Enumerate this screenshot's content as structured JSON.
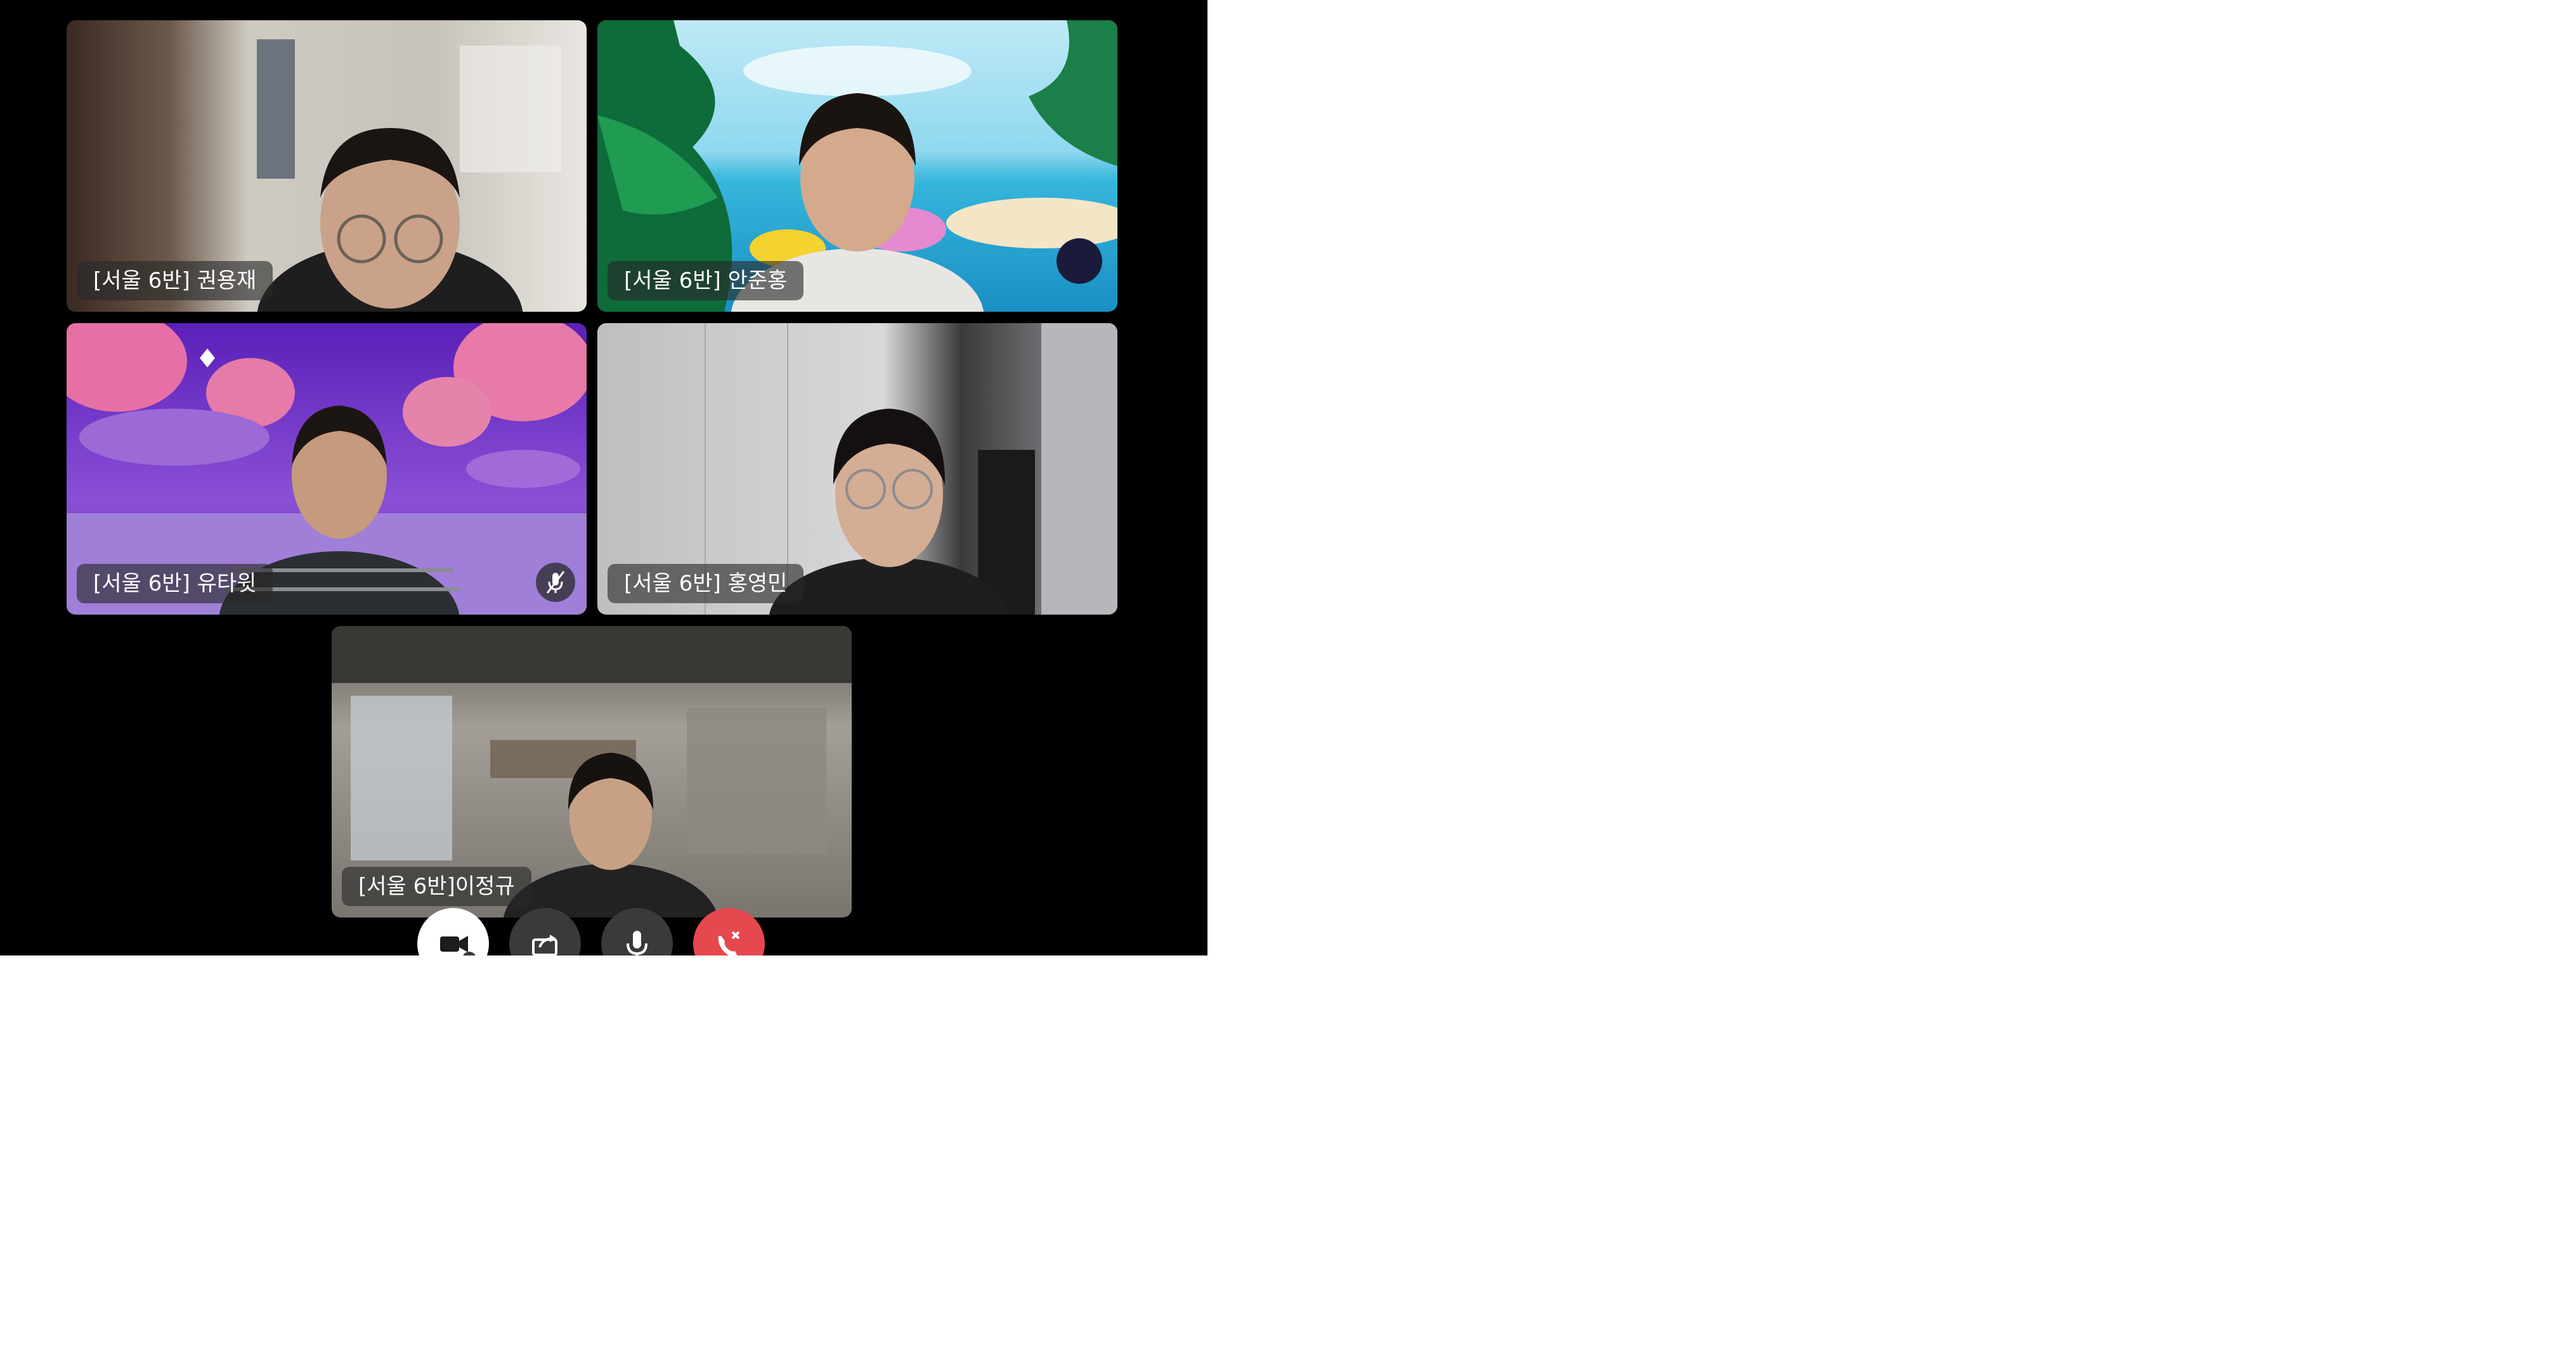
{
  "participants": [
    {
      "label": "[서울 6반] 권용재",
      "muted": false
    },
    {
      "label": "[서울 6반] 안준홍",
      "muted": false
    },
    {
      "label": "[서울 6반] 유타윗",
      "muted": true
    },
    {
      "label": "[서울 6반] 홍영민",
      "muted": false
    },
    {
      "label": "[서울 6반]이정규",
      "muted": false
    }
  ],
  "controls": {
    "camera": {
      "icon": "video-camera-icon",
      "state": "on"
    },
    "share": {
      "icon": "share-screen-icon"
    },
    "mic": {
      "icon": "microphone-icon"
    },
    "end": {
      "icon": "end-call-icon"
    }
  },
  "colors": {
    "background": "#000000",
    "end_call": "#e5484d",
    "control_dark": "#3a3a3c",
    "label_bg": "rgba(40,40,40,0.62)"
  }
}
